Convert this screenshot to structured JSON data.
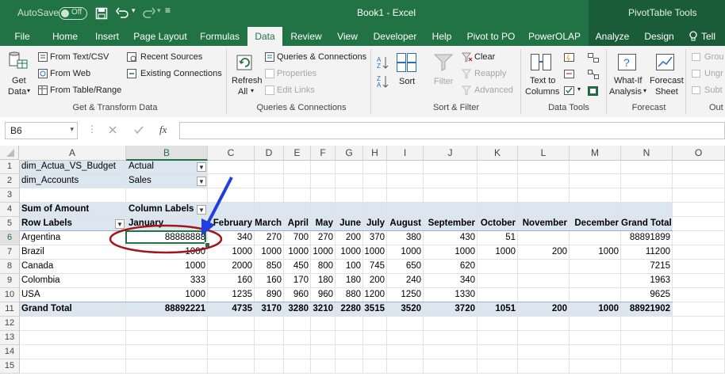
{
  "titlebar": {
    "autosave_label": "AutoSave",
    "autosave_state": "Off",
    "title": "Book1 - Excel",
    "context_tools": "PivotTable Tools"
  },
  "tabs": [
    "File",
    "Home",
    "Insert",
    "Page Layout",
    "Formulas",
    "Data",
    "Review",
    "View",
    "Developer",
    "Help",
    "Pivot to PO",
    "PowerOLAP",
    "Analyze",
    "Design",
    "Tell m"
  ],
  "active_tab": "Data",
  "ribbon": {
    "get_data": [
      "Get",
      "Data"
    ],
    "from_text_csv": "From Text/CSV",
    "from_web": "From Web",
    "from_table_range": "From Table/Range",
    "recent_sources": "Recent Sources",
    "existing_connections": "Existing Connections",
    "group_get_transform": "Get & Transform Data",
    "refresh_all": [
      "Refresh",
      "All"
    ],
    "queries_connections_btn": "Queries & Connections",
    "properties": "Properties",
    "edit_links": "Edit Links",
    "group_queries": "Queries & Connections",
    "sort": "Sort",
    "filter": "Filter",
    "clear": "Clear",
    "reapply": "Reapply",
    "advanced": "Advanced",
    "group_sort_filter": "Sort & Filter",
    "text_to_columns": [
      "Text to",
      "Columns"
    ],
    "group_data_tools": "Data Tools",
    "what_if": [
      "What-If",
      "Analysis"
    ],
    "forecast_sheet": [
      "Forecast",
      "Sheet"
    ],
    "group_forecast": "Forecast",
    "outline_items": [
      "Grou",
      "Ungr",
      "Subt"
    ],
    "group_outline": "Out"
  },
  "formula_bar": {
    "name_box": "B6",
    "fx": "fx",
    "formula": ""
  },
  "columns": [
    "A",
    "B",
    "C",
    "D",
    "E",
    "F",
    "G",
    "H",
    "I",
    "J",
    "K",
    "L",
    "M",
    "N",
    "O"
  ],
  "rows": [
    "1",
    "2",
    "3",
    "4",
    "5",
    "6",
    "7",
    "8",
    "9",
    "10",
    "11",
    "12",
    "13",
    "14",
    "15"
  ],
  "pivot": {
    "filters": [
      {
        "field": "dim_Actua_VS_Budget",
        "value": "Actual"
      },
      {
        "field": "dim_Accounts",
        "value": "Sales"
      }
    ],
    "values_label": "Sum of Amount",
    "column_labels": "Column Labels",
    "row_labels": "Row Labels",
    "months": [
      "January",
      "February",
      "March",
      "April",
      "May",
      "June",
      "July",
      "August",
      "September",
      "October",
      "November",
      "December",
      "Grand Total"
    ],
    "rows": [
      {
        "label": "Argentina",
        "values": [
          "88888888",
          "340",
          "270",
          "700",
          "270",
          "200",
          "370",
          "380",
          "430",
          "51",
          "",
          "",
          "88891899"
        ]
      },
      {
        "label": "Brazil",
        "values": [
          "1000",
          "1000",
          "1000",
          "1000",
          "1000",
          "1000",
          "1000",
          "1000",
          "1000",
          "1000",
          "200",
          "1000",
          "11200"
        ]
      },
      {
        "label": "Canada",
        "values": [
          "1000",
          "2000",
          "850",
          "450",
          "800",
          "100",
          "745",
          "650",
          "620",
          "",
          "",
          "",
          "7215"
        ]
      },
      {
        "label": "Colombia",
        "values": [
          "333",
          "160",
          "160",
          "170",
          "180",
          "180",
          "200",
          "240",
          "340",
          "",
          "",
          "",
          "1963"
        ]
      },
      {
        "label": "USA",
        "values": [
          "1000",
          "1235",
          "890",
          "960",
          "960",
          "880",
          "1200",
          "1250",
          "1330",
          "",
          "",
          "",
          "9625"
        ]
      }
    ],
    "grand_total": {
      "label": "Grand Total",
      "values": [
        "88892221",
        "4735",
        "3170",
        "3280",
        "3210",
        "2280",
        "3515",
        "3520",
        "3720",
        "1051",
        "200",
        "1000",
        "88921902"
      ]
    }
  },
  "annotation": {
    "arrow_color": "#1f3fe0",
    "circle_color": "#a3151a"
  }
}
